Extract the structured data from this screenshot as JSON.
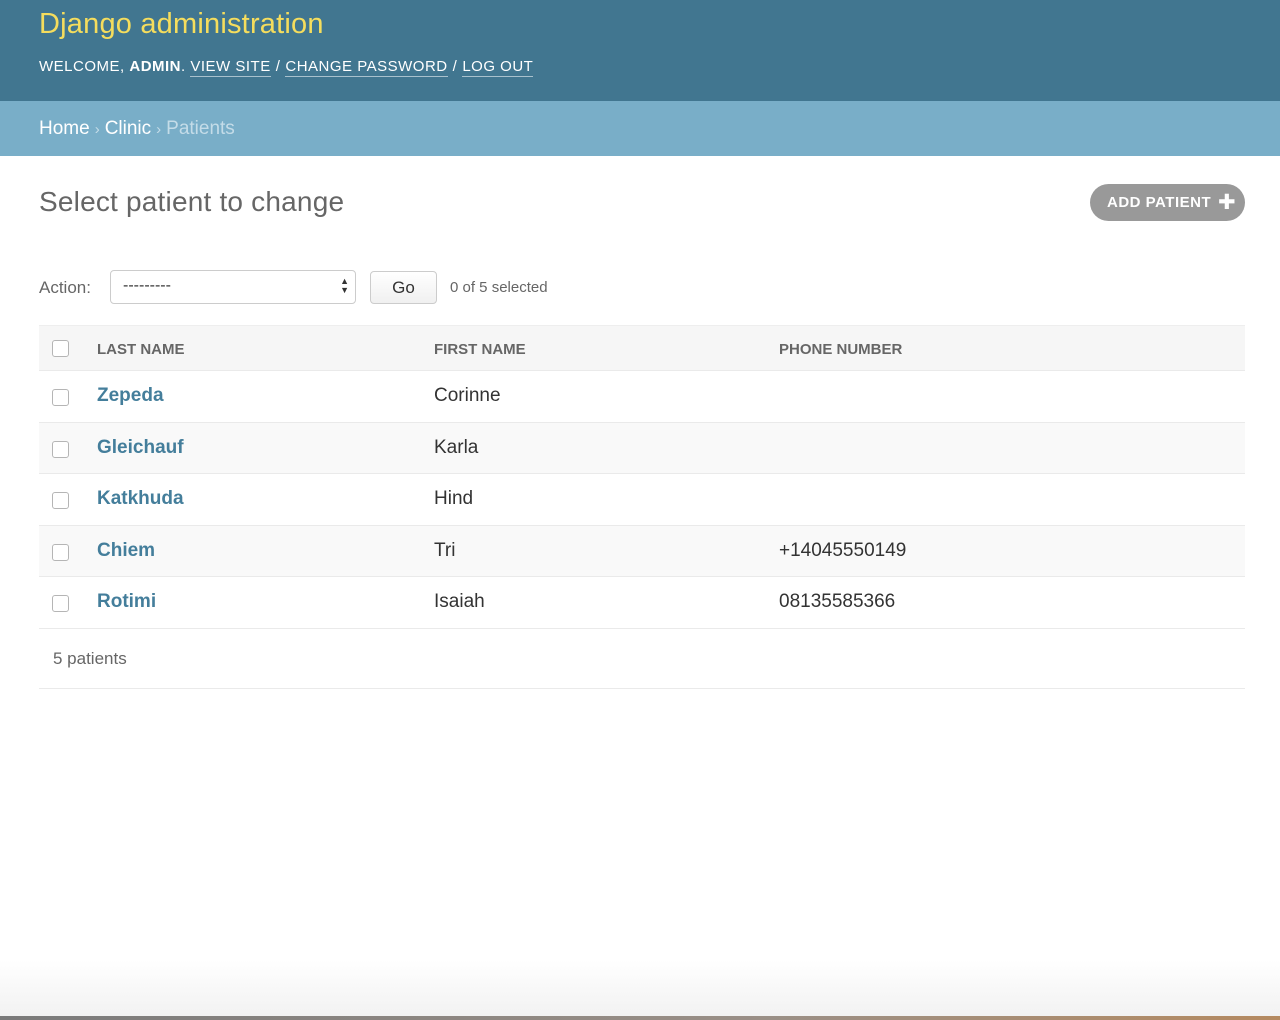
{
  "header": {
    "site_name": "Django administration",
    "welcome": "Welcome,",
    "username": "admin",
    "links": [
      "View site",
      "Change password",
      "Log out"
    ],
    "separator": "/"
  },
  "breadcrumbs": {
    "items": [
      "Home",
      "Clinic"
    ],
    "current": "Patients",
    "separator": "›"
  },
  "content": {
    "title": "Select patient to change",
    "add_button": "Add patient",
    "add_icon": "plus-icon"
  },
  "actions": {
    "label": "Action:",
    "selected_option": "---------",
    "go_label": "Go",
    "selected_counter": "0 of 5 selected"
  },
  "table": {
    "columns": [
      "Last name",
      "First name",
      "Phone number"
    ],
    "rows": [
      {
        "last_name": "Zepeda",
        "first_name": "Corinne",
        "phone": ""
      },
      {
        "last_name": "Gleichauf",
        "first_name": "Karla",
        "phone": ""
      },
      {
        "last_name": "Katkhuda",
        "first_name": "Hind",
        "phone": ""
      },
      {
        "last_name": "Chiem",
        "first_name": "Tri",
        "phone": "+14045550149"
      },
      {
        "last_name": "Rotimi",
        "first_name": "Isaiah",
        "phone": "08135585366"
      }
    ]
  },
  "paginator": "5 patients",
  "colors": {
    "header_bg": "#417690",
    "brand_yellow": "#f5dd5d",
    "breadcrumb_bg": "#79aec8",
    "link_blue": "#447e9b",
    "add_button_bg": "#999999"
  }
}
